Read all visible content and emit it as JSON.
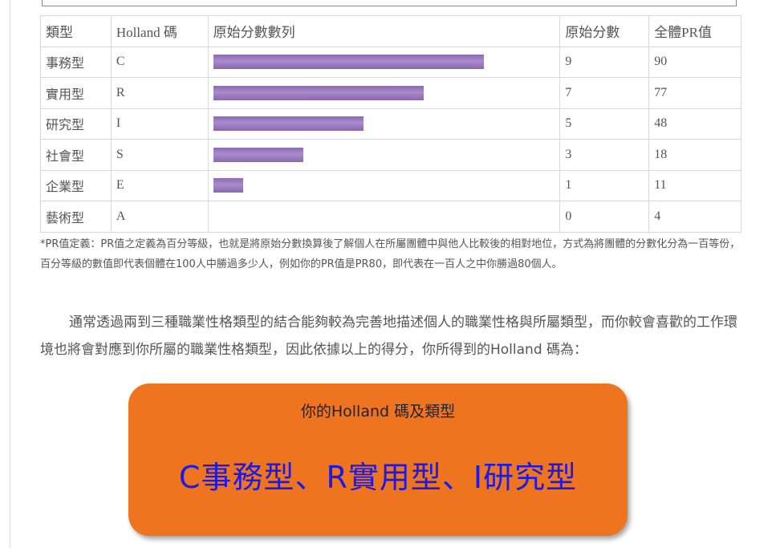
{
  "table": {
    "headers": [
      "類型",
      "Holland 碼",
      "原始分數數列",
      "原始分數",
      "全體PR值"
    ],
    "max_score": 9,
    "rows": [
      {
        "type": "事務型",
        "code": "C",
        "score": "9",
        "pr": "90",
        "bar_value": 9
      },
      {
        "type": "實用型",
        "code": "R",
        "score": "7",
        "pr": "77",
        "bar_value": 7
      },
      {
        "type": "研究型",
        "code": "I",
        "score": "5",
        "pr": "48",
        "bar_value": 5
      },
      {
        "type": "社會型",
        "code": "S",
        "score": "3",
        "pr": "18",
        "bar_value": 3
      },
      {
        "type": "企業型",
        "code": "E",
        "score": "1",
        "pr": "11",
        "bar_value": 1
      },
      {
        "type": "藝術型",
        "code": "A",
        "score": "0",
        "pr": "4",
        "bar_value": 0
      }
    ],
    "bar_color": "#9070b8"
  },
  "note": "*PR值定義：PR值之定義為百分等級，也就是將原始分數換算後了解個人在所屬團體中與他人比較後的相對地位，方式為將團體的分數化分為一百等份，百分等級的數值即代表個體在100人中勝過多少人，例如你的PR值是PR80，即代表在一百人之中你勝過80個人。",
  "paragraph": "通常透過兩到三種職業性格類型的結合能夠較為完善地描述個人的職業性格與所屬類型，而你較會喜歡的工作環境也將會對應到你所屬的職業性格類型，因此依據以上的得分，你所得到的Holland 碼為：",
  "result": {
    "heading": "你的Holland 碼及類型",
    "value": "C事務型、R實用型、I研究型",
    "box_color": "#ee7420",
    "text_color": "#1a1ae6"
  }
}
